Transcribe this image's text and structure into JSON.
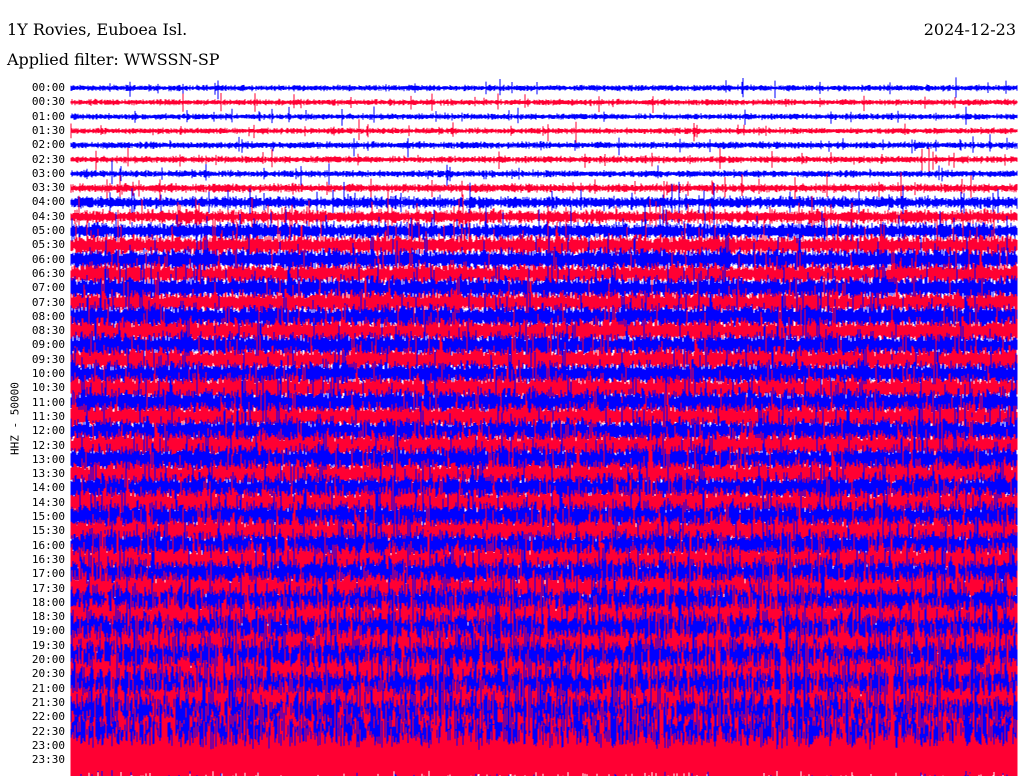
{
  "header": {
    "station": "1Y Rovies, Euboea Isl.",
    "date": "2024-12-23",
    "filter": "Applied filter: WWSSN-SP"
  },
  "chart_data": {
    "type": "line",
    "title": "1Y Rovies, Euboea Isl.",
    "subtitle": "Applied filter: WWSSN-SP",
    "ylabel": "HHZ - 50000",
    "xlabel": "",
    "grid": false,
    "colors": [
      "#0000ff",
      "#ff0033"
    ],
    "row_labels": [
      "00:00",
      "00:30",
      "01:00",
      "01:30",
      "02:00",
      "02:30",
      "03:00",
      "03:30",
      "04:00",
      "04:30",
      "05:00",
      "05:30",
      "06:00",
      "06:30",
      "07:00",
      "07:30",
      "08:00",
      "08:30",
      "09:00",
      "09:30",
      "10:00",
      "10:30",
      "11:00",
      "11:30",
      "12:00",
      "12:30",
      "13:00",
      "13:30",
      "14:00",
      "14:30",
      "15:00",
      "15:30",
      "16:00",
      "16:30",
      "17:00",
      "17:30",
      "18:00",
      "18:30",
      "19:00",
      "19:30",
      "20:00",
      "20:30",
      "21:00",
      "21:30",
      "22:00",
      "22:30",
      "23:00",
      "23:30"
    ],
    "relative_amplitude": [
      0.35,
      0.35,
      0.35,
      0.35,
      0.4,
      0.4,
      0.4,
      0.5,
      0.7,
      0.8,
      1.0,
      1.2,
      1.3,
      1.3,
      1.4,
      1.4,
      1.5,
      1.5,
      1.5,
      1.5,
      1.5,
      1.6,
      1.6,
      1.6,
      1.6,
      1.7,
      1.7,
      1.7,
      1.7,
      1.8,
      1.8,
      1.8,
      1.8,
      1.9,
      1.9,
      2.0,
      2.0,
      2.2,
      2.3,
      2.4,
      2.5,
      2.5,
      2.5,
      2.6,
      2.8,
      3.0,
      4.5,
      4.5
    ]
  }
}
